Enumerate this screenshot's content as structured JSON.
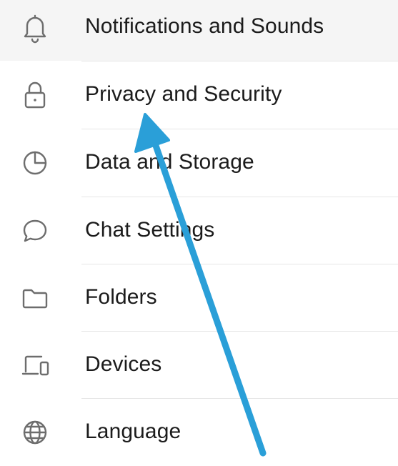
{
  "settings": {
    "items": [
      {
        "label": "Notifications and Sounds",
        "icon": "bell-icon"
      },
      {
        "label": "Privacy and Security",
        "icon": "lock-icon"
      },
      {
        "label": "Data and Storage",
        "icon": "pie-chart-icon"
      },
      {
        "label": "Chat Settings",
        "icon": "chat-bubble-icon"
      },
      {
        "label": "Folders",
        "icon": "folder-icon"
      },
      {
        "label": "Devices",
        "icon": "devices-icon"
      },
      {
        "label": "Language",
        "icon": "globe-icon"
      }
    ]
  },
  "colors": {
    "text": "#1b1b1b",
    "icon": "#6d6d6d",
    "divider": "#e6e6e6",
    "row_highlight": "#f5f5f5",
    "annotation_arrow": "#2a9fd8"
  }
}
